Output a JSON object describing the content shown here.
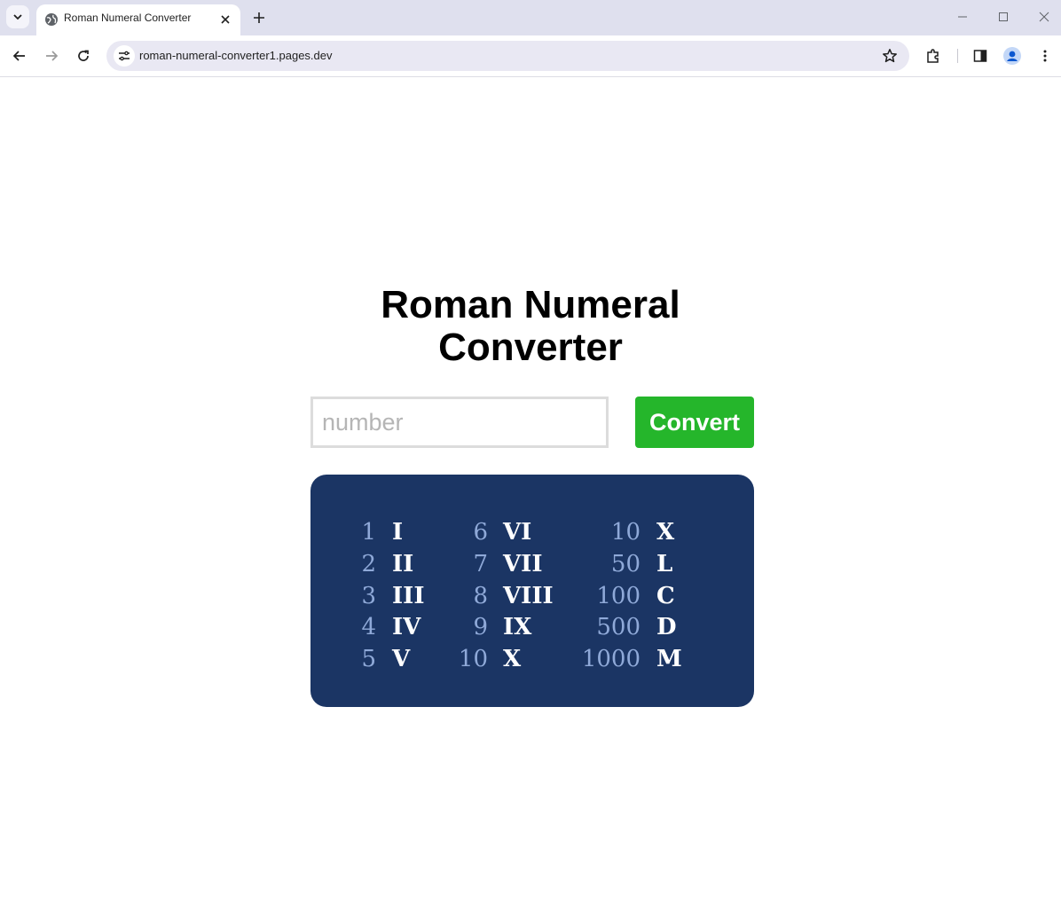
{
  "browser": {
    "tab_title": "Roman Numeral Converter",
    "url": "roman-numeral-converter1.pages.dev"
  },
  "page": {
    "title_line1": "Roman Numeral",
    "title_line2": "Converter",
    "input_placeholder": "number",
    "input_value": "",
    "convert_label": "Convert",
    "panel_color": "#1b3564",
    "button_color": "#25b62b"
  },
  "reference": {
    "columns": [
      [
        {
          "num": "1",
          "roman": "I"
        },
        {
          "num": "2",
          "roman": "II"
        },
        {
          "num": "3",
          "roman": "III"
        },
        {
          "num": "4",
          "roman": "IV"
        },
        {
          "num": "5",
          "roman": "V"
        }
      ],
      [
        {
          "num": "6",
          "roman": "VI"
        },
        {
          "num": "7",
          "roman": "VII"
        },
        {
          "num": "8",
          "roman": "VIII"
        },
        {
          "num": "9",
          "roman": "IX"
        },
        {
          "num": "10",
          "roman": "X"
        }
      ],
      [
        {
          "num": "10",
          "roman": "X"
        },
        {
          "num": "50",
          "roman": "L"
        },
        {
          "num": "100",
          "roman": "C"
        },
        {
          "num": "500",
          "roman": "D"
        },
        {
          "num": "1000",
          "roman": "M"
        }
      ]
    ]
  }
}
